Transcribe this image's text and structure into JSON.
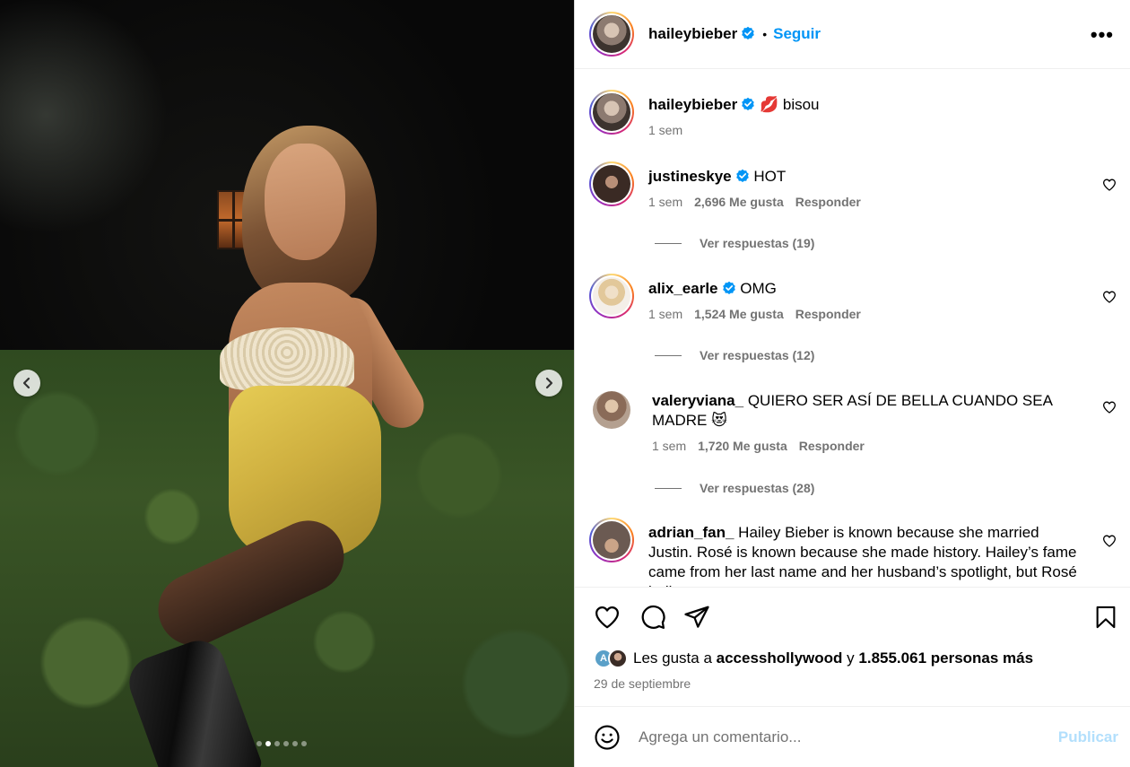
{
  "post": {
    "username": "haileybieber",
    "separator": "•",
    "follow_label": "Seguir",
    "more_label": "•••",
    "media_dot_count": 6,
    "media_active_dot": 1
  },
  "caption": {
    "username": "haileybieber",
    "emoji": "💋",
    "text": "bisou",
    "time": "1 sem"
  },
  "comments": [
    {
      "username": "justineskye",
      "verified": true,
      "text": "HOT",
      "time": "1 sem",
      "likes": "2,696 Me gusta",
      "reply_label": "Responder",
      "view_replies": "Ver respuestas (19)"
    },
    {
      "username": "alix_earle",
      "verified": true,
      "text": "OMG",
      "time": "1 sem",
      "likes": "1,524 Me gusta",
      "reply_label": "Responder",
      "view_replies": "Ver respuestas (12)"
    },
    {
      "username": "valeryviana_",
      "verified": false,
      "text": "QUIERO SER ASÍ DE BELLA CUANDO SEA MADRE",
      "emoji": "😻",
      "time": "1 sem",
      "likes": "1,720 Me gusta",
      "reply_label": "Responder",
      "view_replies": "Ver respuestas (28)"
    },
    {
      "username": "adrian_fan_",
      "verified": false,
      "text": "Hailey Bieber is known because she married Justin. Rosé is known because she made history. Hailey’s fame came from her last name and her husband’s spotlight, but Rosé built"
    }
  ],
  "likes_summary": {
    "prefix": "Les gusta a",
    "user": "accesshollywood",
    "conjunction": "y",
    "others": "1.855.061 personas más",
    "mini_avatar_letter": "A"
  },
  "date": "29 de septiembre",
  "add_comment": {
    "placeholder": "Agrega un comentario...",
    "publish_label": "Publicar"
  },
  "colors": {
    "link_blue": "#0095f6",
    "publish_disabled": "#b2dffc",
    "verified_blue": "#0095f6",
    "secondary_text": "#737373"
  }
}
